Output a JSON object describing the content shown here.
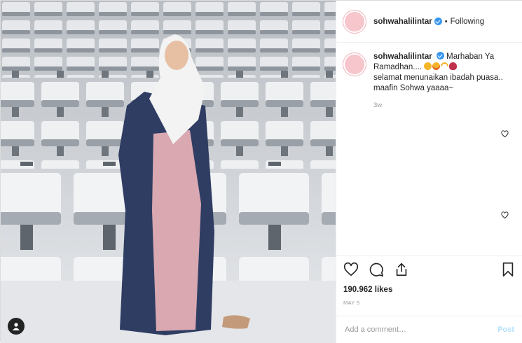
{
  "post": {
    "username": "sohwahalilintar",
    "follow_separator": "•",
    "follow_state": "Following",
    "caption_line1": "Marhaban Ya Ramadhan....",
    "caption_line2": "selamat menunaikan ibadah puasa..",
    "caption_line3": "maafin Sohwa yaaaa~",
    "caption_time": "3w",
    "likes": "190.962 likes",
    "date": "MAY 5",
    "comment_placeholder": "Add a comment…",
    "post_label": "Post"
  },
  "colors": {
    "verified": "#3897f0",
    "avatar": "#f6c6cc",
    "post_button": "#b2dffc"
  },
  "icons": [
    "heart-icon",
    "comment-icon",
    "share-icon",
    "bookmark-icon",
    "user-tag-icon",
    "verified-badge-icon"
  ]
}
